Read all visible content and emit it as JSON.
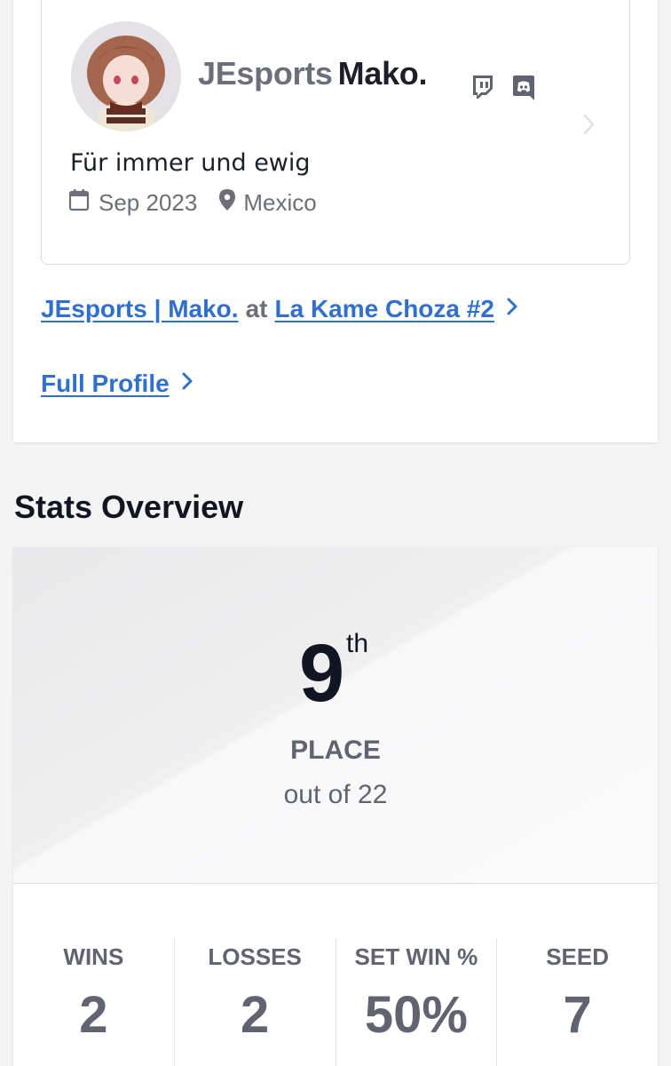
{
  "profile": {
    "prefix": "JEsports",
    "gamertag": "Mako.",
    "bio": "Für immer und ewig",
    "joined": "Sep 2023",
    "location": "Mexico",
    "social_icons": [
      "twitch-icon",
      "discord-icon"
    ]
  },
  "links": {
    "entrant_prefix": "JEsports | Mako.",
    "entrant_at": "at",
    "entrant_event": "La Kame Choza #2",
    "full_profile": "Full Profile"
  },
  "stats": {
    "section_title": "Stats Overview",
    "place_number": "9",
    "place_suffix": "th",
    "place_label": "PLACE",
    "place_total": "out of 22",
    "items": [
      {
        "label": "WINS",
        "value": "2"
      },
      {
        "label": "LOSSES",
        "value": "2"
      },
      {
        "label": "SET WIN %",
        "value": "50%"
      },
      {
        "label": "SEED",
        "value": "7"
      }
    ]
  },
  "colors": {
    "link": "#2f6fcd",
    "muted": "#6b6f7a",
    "heading": "#121622"
  }
}
